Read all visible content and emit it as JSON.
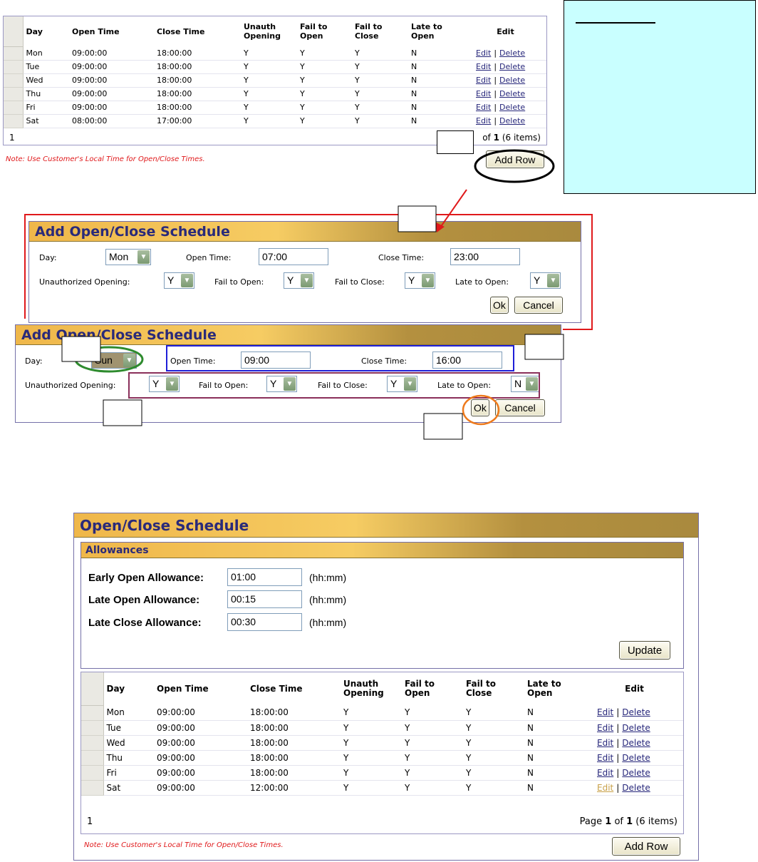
{
  "columns": [
    "Day",
    "Open Time",
    "Close Time",
    "Unauth Opening",
    "Fail to Open",
    "Fail to Close",
    "Late to Open",
    "Edit"
  ],
  "column_lines": [
    [
      "Day"
    ],
    [
      "Open Time"
    ],
    [
      "Close Time"
    ],
    [
      "Unauth",
      "Opening"
    ],
    [
      "Fail to",
      "Open"
    ],
    [
      "Fail to",
      "Close"
    ],
    [
      "Late to",
      "Open"
    ],
    [
      "Edit"
    ]
  ],
  "link_edit": "Edit",
  "link_delete": "Delete",
  "link_sep": "|",
  "top_grid": {
    "rows": [
      [
        "Mon",
        "09:00:00",
        "18:00:00",
        "Y",
        "Y",
        "Y",
        "N"
      ],
      [
        "Tue",
        "09:00:00",
        "18:00:00",
        "Y",
        "Y",
        "Y",
        "N"
      ],
      [
        "Wed",
        "09:00:00",
        "18:00:00",
        "Y",
        "Y",
        "Y",
        "N"
      ],
      [
        "Thu",
        "09:00:00",
        "18:00:00",
        "Y",
        "Y",
        "Y",
        "N"
      ],
      [
        "Fri",
        "09:00:00",
        "18:00:00",
        "Y",
        "Y",
        "Y",
        "N"
      ],
      [
        "Sat",
        "08:00:00",
        "17:00:00",
        "Y",
        "Y",
        "Y",
        "N"
      ]
    ],
    "page_number": "1",
    "page_of": "of",
    "page_total": "1",
    "page_items": "(6 items)"
  },
  "note": "Note: Use Customer's Local Time for Open/Close Times.",
  "add_row_label": "Add Row",
  "dialog1": {
    "title": "Add Open/Close Schedule",
    "day_label": "Day:",
    "day_value": "Mon",
    "open_label": "Open Time:",
    "open_value": "07:00",
    "close_label": "Close Time:",
    "close_value": "23:00",
    "unauth_label": "Unauthorized Opening:",
    "unauth_value": "Y",
    "fail_open_label": "Fail to Open:",
    "fail_open_value": "Y",
    "fail_close_label": "Fail to Close:",
    "fail_close_value": "Y",
    "late_open_label": "Late to Open:",
    "late_open_value": "Y",
    "ok_label": "Ok",
    "cancel_label": "Cancel"
  },
  "dialog2": {
    "title": "Add Open/Close Schedule",
    "day_label": "Day:",
    "day_value": "Sun",
    "open_label": "Open Time:",
    "open_value": "09:00",
    "close_label": "Close Time:",
    "close_value": "16:00",
    "unauth_label": "Unauthorized Opening:",
    "unauth_value": "Y",
    "fail_open_label": "Fail to Open:",
    "fail_open_value": "Y",
    "fail_close_label": "Fail to Close:",
    "fail_close_value": "Y",
    "late_open_label": "Late to Open:",
    "late_open_value": "N",
    "ok_label": "Ok",
    "cancel_label": "Cancel"
  },
  "schedule": {
    "title": "Open/Close Schedule",
    "allowances_title": "Allowances",
    "early_label": "Early Open Allowance:",
    "early_value": "01:00",
    "late_open_label": "Late Open Allowance:",
    "late_open_value": "00:15",
    "late_close_label": "Late Close Allowance:",
    "late_close_value": "00:30",
    "unit": "(hh:mm)",
    "update_label": "Update",
    "grid": {
      "rows": [
        [
          "Mon",
          "09:00:00",
          "18:00:00",
          "Y",
          "Y",
          "Y",
          "N"
        ],
        [
          "Tue",
          "09:00:00",
          "18:00:00",
          "Y",
          "Y",
          "Y",
          "N"
        ],
        [
          "Wed",
          "09:00:00",
          "18:00:00",
          "Y",
          "Y",
          "Y",
          "N"
        ],
        [
          "Thu",
          "09:00:00",
          "18:00:00",
          "Y",
          "Y",
          "Y",
          "N"
        ],
        [
          "Fri",
          "09:00:00",
          "18:00:00",
          "Y",
          "Y",
          "Y",
          "N"
        ],
        [
          "Sat",
          "09:00:00",
          "12:00:00",
          "Y",
          "Y",
          "Y",
          "N"
        ]
      ],
      "page_number": "1",
      "page_word": "Page",
      "page_current": "1",
      "page_of": "of",
      "page_total": "1",
      "page_items": "(6 items)",
      "active_edit_row": 5
    }
  },
  "colors": {
    "annotation_red": "#e0191b",
    "annotation_green": "#2e8b2e",
    "annotation_blue": "#1f1fd8",
    "annotation_purple": "#8a2f5a",
    "annotation_orange": "#ee7a1c",
    "title_text": "#2a2a7a",
    "callout_fill": "#c9ffff"
  }
}
